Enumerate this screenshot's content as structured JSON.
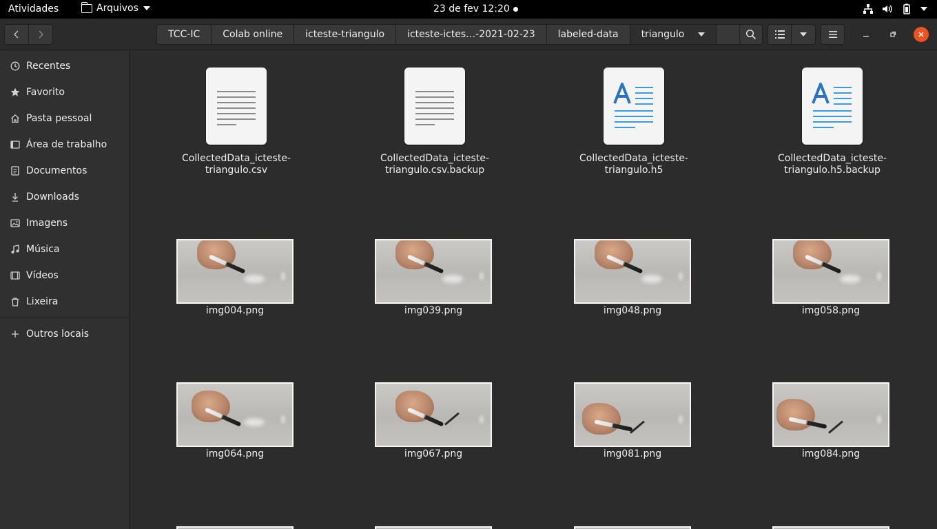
{
  "topbar": {
    "activities": "Atividades",
    "app_menu": "Arquivos",
    "clock": "23 de fev  12:20"
  },
  "nav": {
    "path": [
      "TCC-IC",
      "Colab online",
      "icteste-triangulo",
      "icteste-ictes…-2021-02-23",
      "labeled-data",
      "triangulo"
    ]
  },
  "sidebar": {
    "items": [
      {
        "label": "Recentes",
        "icon": "clock-icon"
      },
      {
        "label": "Favorito",
        "icon": "star-icon"
      },
      {
        "label": "Pasta pessoal",
        "icon": "home-icon"
      },
      {
        "label": "Área de trabalho",
        "icon": "desktop-icon"
      },
      {
        "label": "Documentos",
        "icon": "document-icon"
      },
      {
        "label": "Downloads",
        "icon": "download-icon"
      },
      {
        "label": "Imagens",
        "icon": "image-icon"
      },
      {
        "label": "Música",
        "icon": "music-icon"
      },
      {
        "label": "Vídeos",
        "icon": "video-icon"
      },
      {
        "label": "Lixeira",
        "icon": "trash-icon"
      }
    ],
    "other": "Outros locais"
  },
  "files": {
    "docs": [
      {
        "name1": "CollectedData_icteste-",
        "name2": "triangulo.csv",
        "kind": "text-icon"
      },
      {
        "name1": "CollectedData_icteste-",
        "name2": "triangulo.csv.backup",
        "kind": "text-icon"
      },
      {
        "name1": "CollectedData_icteste-",
        "name2": "triangulo.h5",
        "kind": "rich-text-icon"
      },
      {
        "name1": "CollectedData_icteste-",
        "name2": "triangulo.h5.backup",
        "kind": "rich-text-icon"
      }
    ],
    "images": [
      "img004.png",
      "img039.png",
      "img048.png",
      "img058.png",
      "img064.png",
      "img067.png",
      "img081.png",
      "img084.png"
    ]
  },
  "colors": {
    "accent": "#e95420",
    "doc_blue": "#2a74c2"
  }
}
